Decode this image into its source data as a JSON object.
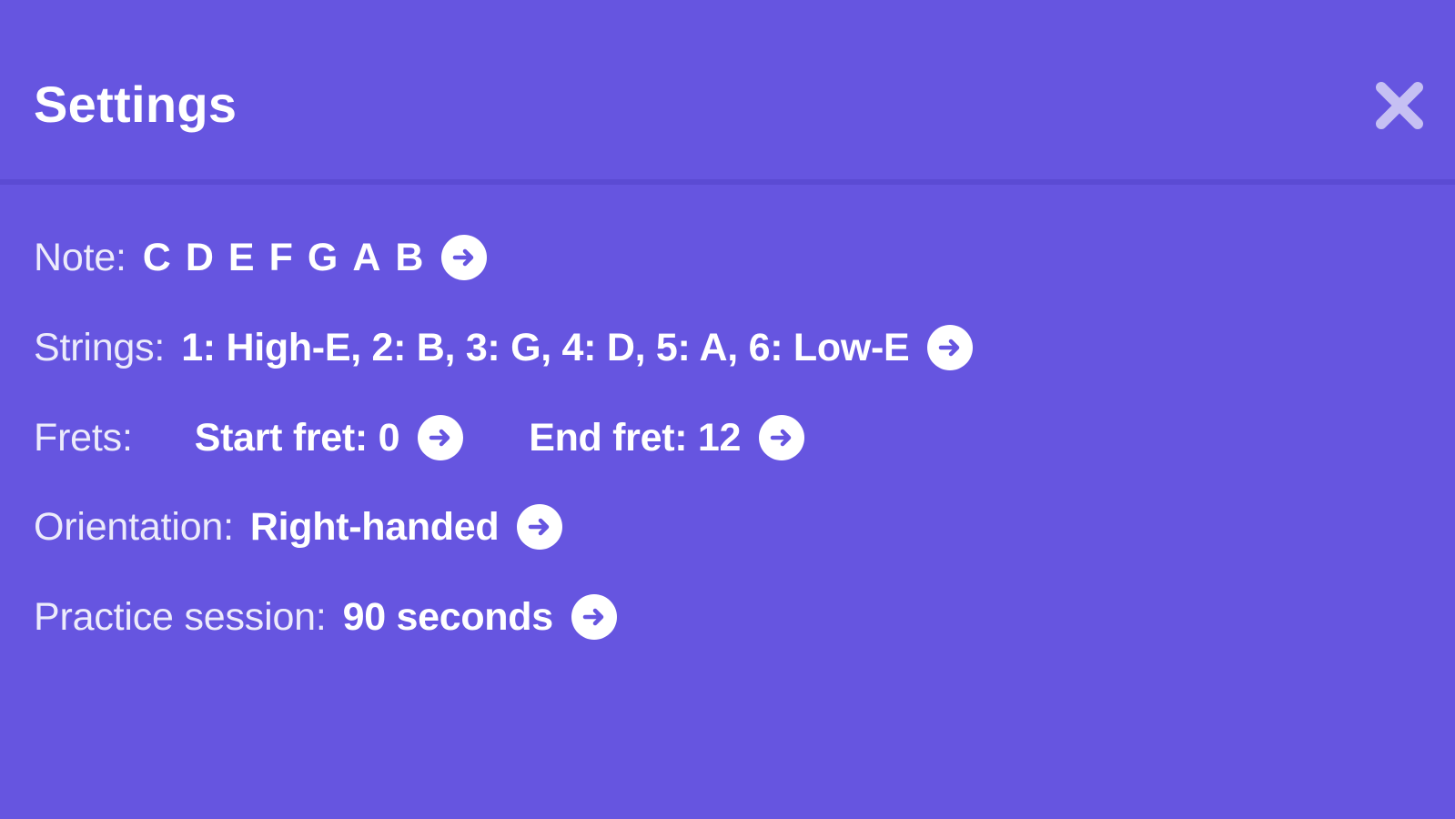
{
  "header": {
    "title": "Settings",
    "close_icon": "close-icon"
  },
  "settings": {
    "note": {
      "label": "Note:",
      "items": [
        "C",
        "D",
        "E",
        "F",
        "G",
        "A",
        "B"
      ],
      "action_icon": "arrow-right-circle-icon"
    },
    "strings": {
      "label": "Strings:",
      "value": "1: High-E, 2: B, 3: G, 4: D, 5: A, 6: Low-E",
      "action_icon": "arrow-right-circle-icon"
    },
    "frets": {
      "label": "Frets:",
      "start_value": "Start fret: 0",
      "end_value": "End fret: 12",
      "action_icon": "arrow-right-circle-icon"
    },
    "orientation": {
      "label": "Orientation:",
      "value": "Right-handed",
      "action_icon": "arrow-right-circle-icon"
    },
    "practice": {
      "label": "Practice session:",
      "value": "90 seconds",
      "action_icon": "arrow-right-circle-icon"
    }
  },
  "colors": {
    "background": "#6655e0",
    "divider": "#5b4bd3",
    "text": "#ffffff",
    "close_icon": "#c6c0f3",
    "arrow_fill": "#6655e0"
  }
}
